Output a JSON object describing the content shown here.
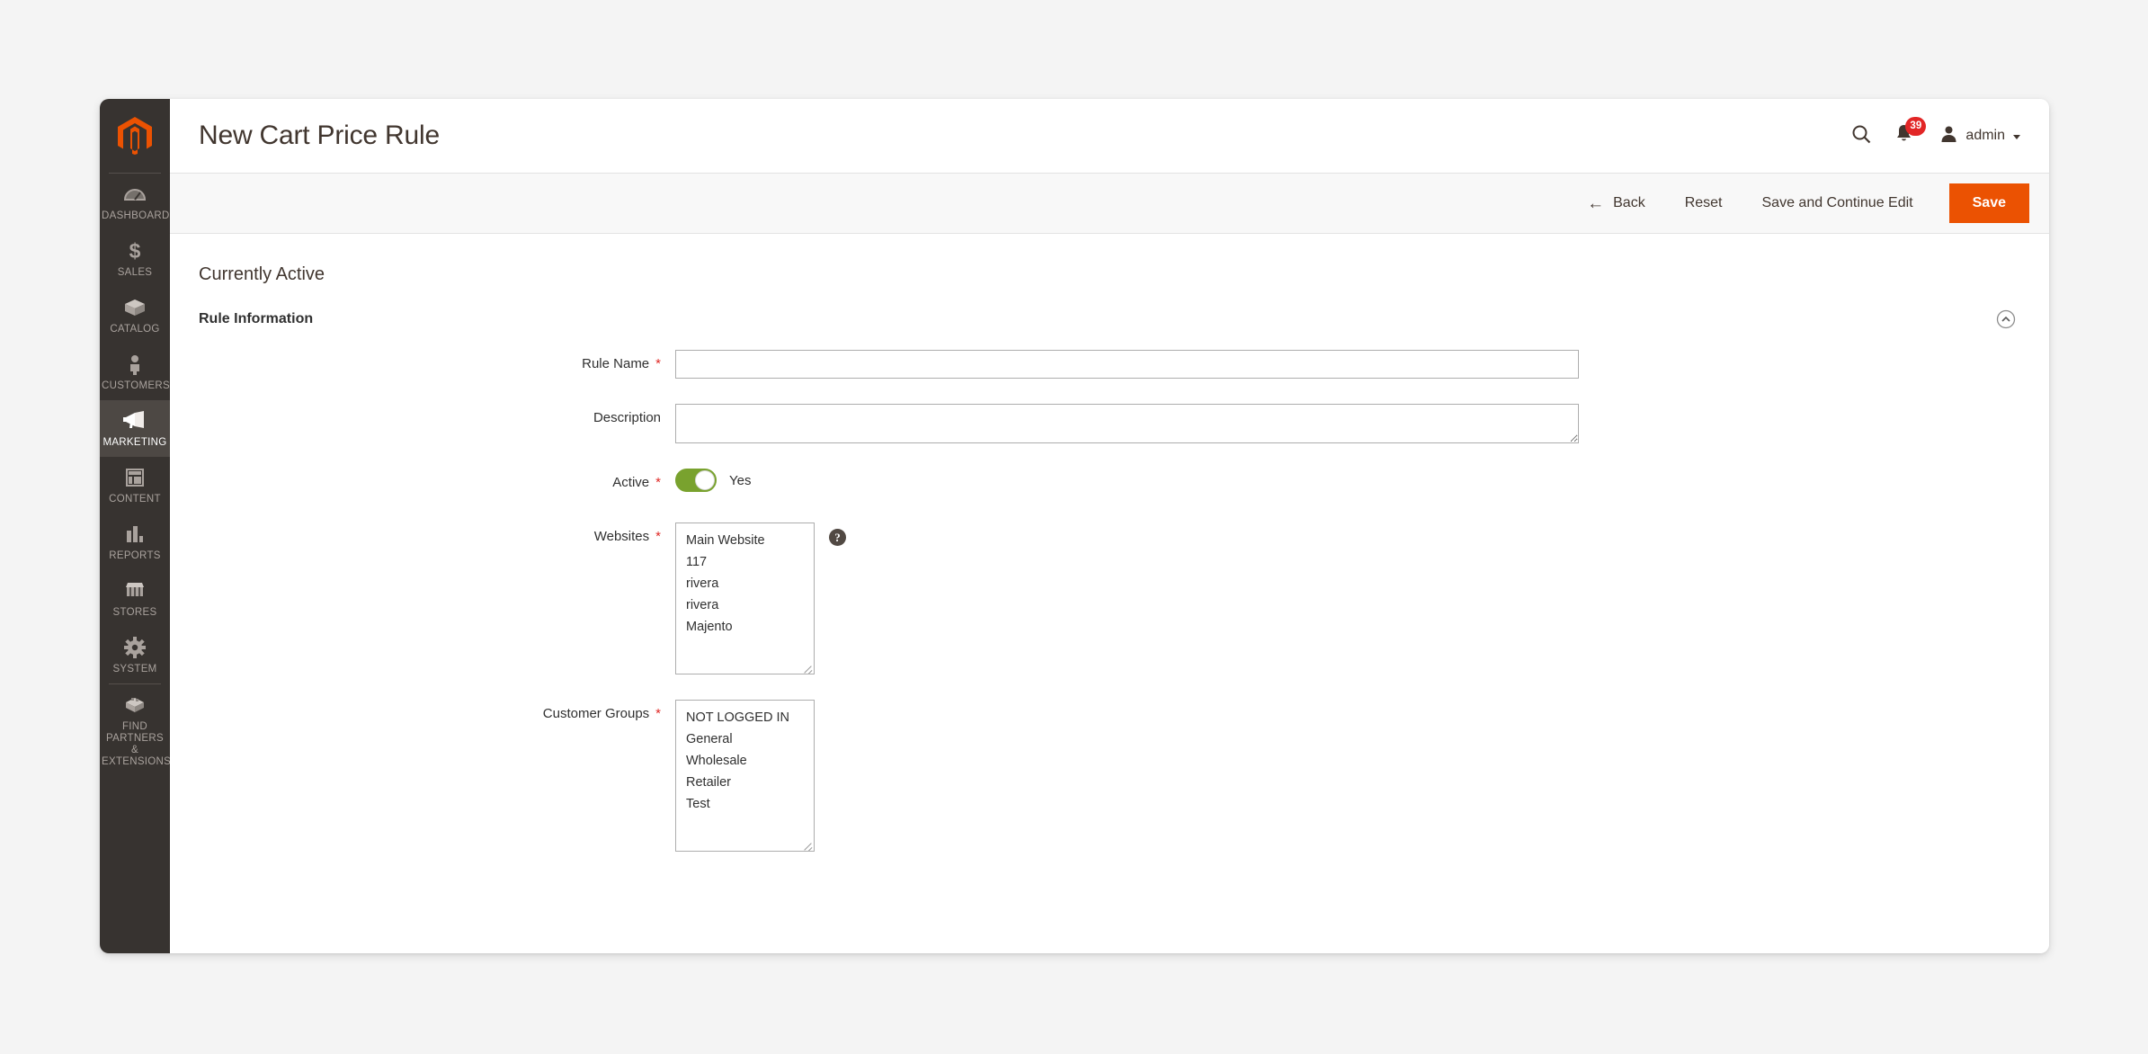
{
  "sidebar": {
    "logo_name": "magento-logo-icon",
    "items": [
      {
        "label": "DASHBOARD",
        "icon": "dashboard-icon",
        "active": false
      },
      {
        "label": "SALES",
        "icon": "dollar-icon",
        "active": false
      },
      {
        "label": "CATALOG",
        "icon": "box-icon",
        "active": false
      },
      {
        "label": "CUSTOMERS",
        "icon": "person-icon",
        "active": false
      },
      {
        "label": "MARKETING",
        "icon": "megaphone-icon",
        "active": true
      },
      {
        "label": "CONTENT",
        "icon": "layout-icon",
        "active": false
      },
      {
        "label": "REPORTS",
        "icon": "bar-chart-icon",
        "active": false
      },
      {
        "label": "STORES",
        "icon": "storefront-icon",
        "active": false
      },
      {
        "label": "SYSTEM",
        "icon": "gear-icon",
        "active": false
      },
      {
        "label": "FIND PARTNERS & EXTENSIONS",
        "icon": "extension-box-icon",
        "active": false
      }
    ]
  },
  "header": {
    "title": "New Cart Price Rule",
    "search_icon": "search-icon",
    "notifications_icon": "bell-icon",
    "notifications_count": "39",
    "avatar_icon": "user-avatar-icon",
    "admin_label": "admin"
  },
  "toolbar": {
    "back_label": "Back",
    "back_icon": "arrow-left-icon",
    "reset_label": "Reset",
    "save_continue_label": "Save and Continue Edit",
    "save_label": "Save",
    "primary_color": "#eb5202"
  },
  "content": {
    "currently_active_label": "Currently Active",
    "section_title": "Rule Information",
    "collapse_icon": "chevron-up-circle-icon",
    "fields": {
      "rule_name": {
        "label": "Rule Name",
        "required": "*",
        "value": "",
        "placeholder": ""
      },
      "description": {
        "label": "Description",
        "required": "",
        "value": "",
        "placeholder": ""
      },
      "active": {
        "label": "Active",
        "required": "*",
        "state_label": "Yes",
        "on": true,
        "on_color": "#79a22e"
      },
      "websites": {
        "label": "Websites",
        "required": "*",
        "help_icon": "question-mark-icon",
        "options": [
          "Main Website",
          "117",
          "rivera",
          "rivera",
          "Majento"
        ]
      },
      "customer_groups": {
        "label": "Customer Groups",
        "required": "*",
        "options": [
          "NOT LOGGED IN",
          "General",
          "Wholesale",
          "Retailer",
          "Test"
        ]
      }
    }
  }
}
